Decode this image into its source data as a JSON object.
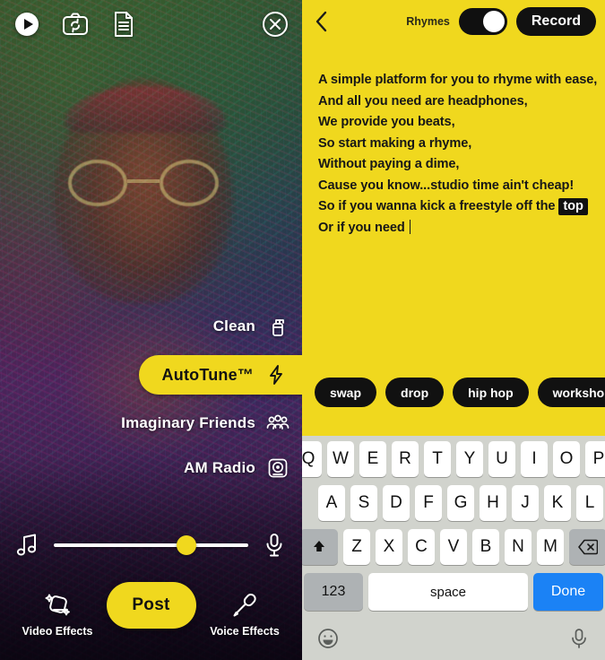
{
  "left_panel": {
    "top_icons": [
      {
        "name": "play-icon",
        "label": "Play"
      },
      {
        "name": "camera-flip-icon",
        "label": "Flip camera"
      },
      {
        "name": "lyrics-document-icon",
        "label": "Lyrics"
      },
      {
        "name": "close-icon",
        "label": "Close"
      }
    ],
    "effects": [
      {
        "label": "Clean",
        "icon": "spray-bottle-icon",
        "active": false
      },
      {
        "label": "AutoTune™",
        "icon": "lightning-bolt-icon",
        "active": true
      },
      {
        "label": "Imaginary Friends",
        "icon": "group-people-icon",
        "active": false
      },
      {
        "label": "AM Radio",
        "icon": "radio-speaker-icon",
        "active": false
      }
    ],
    "slider": {
      "left_icon": "music-note-icon",
      "right_icon": "microphone-icon",
      "value_percent": 68
    },
    "bottom_bar": {
      "left_action": {
        "label": "Video Effects",
        "icon": "video-effects-sparkle-icon"
      },
      "post_label": "Post",
      "right_action": {
        "label": "Voice Effects",
        "icon": "mic-handheld-icon"
      }
    },
    "accent_color": "#F0D81E"
  },
  "right_panel": {
    "header": {
      "back_icon": "chevron-left-icon",
      "rhymes_label": "Rhymes",
      "rhymes_toggle_on": true,
      "record_label": "Record"
    },
    "lyrics_lines": [
      {
        "text": "A simple platform for you to rhyme with ease,",
        "highlight": null,
        "caret": false
      },
      {
        "text": "And all you need are headphones,",
        "highlight": null,
        "caret": false
      },
      {
        "text": "We provide you beats,",
        "highlight": null,
        "caret": false
      },
      {
        "text": "So start making a rhyme,",
        "highlight": null,
        "caret": false
      },
      {
        "text": "Without paying a dime,",
        "highlight": null,
        "caret": false
      },
      {
        "text": "Cause you know...studio time ain't cheap!",
        "highlight": null,
        "caret": false
      },
      {
        "text": "So if you wanna kick a freestyle off the ",
        "highlight": "top",
        "caret": false
      },
      {
        "text": "Or if you need ",
        "highlight": null,
        "caret": true
      }
    ],
    "rhyme_chips": [
      "swap",
      "drop",
      "hip hop",
      "workshop",
      ""
    ],
    "background_color": "#F0D81E"
  },
  "keyboard": {
    "row1": [
      "Q",
      "W",
      "E",
      "R",
      "T",
      "Y",
      "U",
      "I",
      "O",
      "P"
    ],
    "row2": [
      "A",
      "S",
      "D",
      "F",
      "G",
      "H",
      "J",
      "K",
      "L"
    ],
    "row3": [
      "Z",
      "X",
      "C",
      "V",
      "B",
      "N",
      "M"
    ],
    "shift_icon": "shift-arrow-icon",
    "backspace_icon": "backspace-icon",
    "numbers_label": "123",
    "space_label": "space",
    "done_label": "Done",
    "footer": {
      "emoji_icon": "emoji-smiley-icon",
      "dictation_icon": "dictation-microphone-icon"
    },
    "done_color": "#1b82f5"
  }
}
